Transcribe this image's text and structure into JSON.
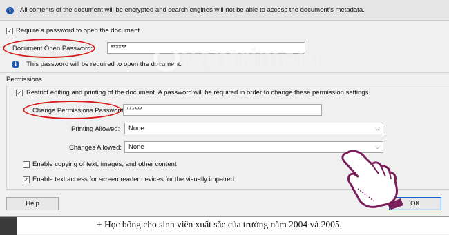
{
  "info": {
    "text": "All contents of the document will be encrypted and search engines will not be able to access the document's metadata.",
    "icon": "info-icon"
  },
  "open_password": {
    "require_label": "Require a password to open the document",
    "require_checked": true,
    "field_label": "Document Open Password:",
    "field_value": "******",
    "note": "This password will be required to open the document."
  },
  "permissions": {
    "group_label": "Permissions",
    "restrict_label": "Restrict editing and printing of the document. A password will be required in order to change these permission settings.",
    "restrict_checked": true,
    "password_label": "Change Permissions Password:",
    "password_value": "******",
    "printing_label": "Printing Allowed:",
    "printing_value": "None",
    "changes_label": "Changes Allowed:",
    "changes_value": "None",
    "copy_label": "Enable copying of text, images, and other content",
    "copy_checked": false,
    "screenreader_label": "Enable text access for screen reader devices for the visually impaired",
    "screenreader_checked": true
  },
  "footer": {
    "help_label": "Help",
    "ok_label": "OK"
  },
  "watermark": "uantrimang",
  "document_line": "+ Học bổng cho sinh viên xuất sắc của trường năm 2004 và 2005.",
  "colors": {
    "highlight_ellipse": "#d81a1a",
    "info_icon": "#1e56b0",
    "ok_border": "#1a66c8"
  }
}
